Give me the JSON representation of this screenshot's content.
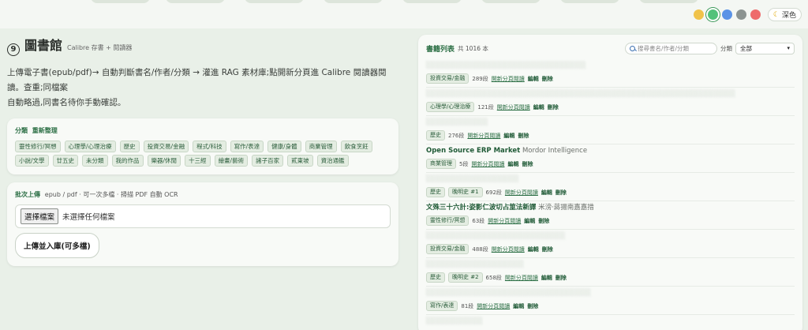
{
  "theme": {
    "swatches": [
      "#f0c34a",
      "#52c27a",
      "#5a93e6",
      "#8c9491",
      "#ee6b6b"
    ],
    "selected_index": 1,
    "dark_label": "深色"
  },
  "library": {
    "index": "9",
    "title": "圖書館",
    "subtitle": "Calibre 存書 + 閱讀器",
    "description_line1": "上傳電子書(epub/pdf)→ 自動判斷書名/作者/分類 → 灌進 RAG 素材庫;點開新分頁進 Calibre 閱讀器閱讀。查重;同檔案",
    "description_line2": "自動略過,同書名待你手動確認。"
  },
  "categories": {
    "title": "分類",
    "action": "重新整理",
    "items": [
      "靈性修行/冥想",
      "心理學/心理治療",
      "歷史",
      "投資交易/金融",
      "程式/科技",
      "寫作/表達",
      "健康/身體",
      "商業管理",
      "飲食烹飪",
      "小說/文學",
      "廿五史",
      "未分類",
      "我的作品",
      "樂器/休閒",
      "十三經",
      "繪畫/藝術",
      "諸子百家",
      "貳東坡",
      "資治通鑑"
    ]
  },
  "upload": {
    "title": "批次上傳",
    "hint": "epub / pdf · 可一次多檔 · 掃描 PDF 自動 OCR",
    "choose_button": "選擇檔案",
    "no_file": "未選擇任何檔案",
    "submit": "上傳並入庫(可多檔)"
  },
  "booklist": {
    "title": "書籍列表",
    "count": "共 1016 本",
    "search_placeholder": "搜尋書名/作者/分類",
    "filter_label": "分類",
    "filter_value": "全部",
    "open_label": "開新分頁閱讀",
    "edit_label": "編輯",
    "delete_label": "刪除",
    "books": [
      {
        "title": "░░░░░░░░░░░░░░░░░░░░░░░░░░░░░░░",
        "author": "",
        "blurred": true,
        "tags": [
          "投資交易/金融"
        ],
        "count": "289段"
      },
      {
        "title": "░░░░░░░░░░░░░░░░░░░░░░░░░░░░░░░░░░░░░░░░░░░░░░░░░░░░░░░░░░░░",
        "author": "",
        "blurred": true,
        "tags": [
          "心理學/心理治療"
        ],
        "count": "121段"
      },
      {
        "title": "░░░░░░░░░░░░",
        "author": "",
        "blurred": true,
        "tags": [
          "歷史"
        ],
        "count": "276段"
      },
      {
        "title": "Open Source ERP Market",
        "author": "Mordor Intelligence",
        "blurred": false,
        "tags": [
          "商業管理"
        ],
        "count": "5段"
      },
      {
        "title": "░░░░░░░░░░░░░░░░░░",
        "author": "",
        "blurred": true,
        "tags": [
          "歷史",
          "晚明史 #1"
        ],
        "count": "692段"
      },
      {
        "title": "文殊三十六計:姿影仁波切占筮法新譯",
        "author": "米滂·蔣揚南嘉嘉措",
        "blurred": false,
        "tags": [
          "靈性修行/冥想"
        ],
        "count": "63段"
      },
      {
        "title": "░░░░░░░░░░░░░░░░░░░░░░░░░░░",
        "author": "",
        "blurred": true,
        "tags": [
          "投資交易/金融"
        ],
        "count": "488段"
      },
      {
        "title": "░░░░░░░░░░░░░░░░░░░",
        "author": "",
        "blurred": true,
        "tags": [
          "歷史",
          "晚明史 #2"
        ],
        "count": "658段"
      },
      {
        "title": "░░░░░░░░░░░░░░░░░░░░░░░░░░░░░░░░",
        "author": "",
        "blurred": true,
        "tags": [
          "寫作/表達"
        ],
        "count": "81段"
      },
      {
        "title": "░░░░░░░░░░░",
        "author": "",
        "blurred": true,
        "tags": [],
        "count": ""
      }
    ]
  }
}
